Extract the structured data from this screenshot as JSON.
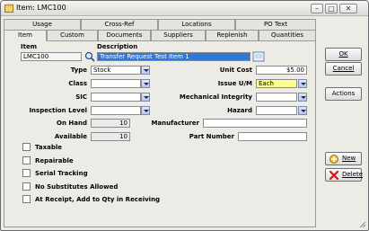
{
  "window": {
    "title": "Item: LMC100"
  },
  "tabs_row1": [
    "Usage",
    "Cross-Ref",
    "Locations",
    "PO Text"
  ],
  "tabs_row2": [
    "Item",
    "Custom",
    "Documents",
    "Suppliers",
    "Replenish",
    "Quantities"
  ],
  "header": {
    "item_label": "Item",
    "item_value": "LMC100",
    "description_label": "Description",
    "description_value": "Transfer Request Test Item 1"
  },
  "fields": {
    "type_label": "Type",
    "type_value": "Stock",
    "class_label": "Class",
    "class_value": "",
    "sic_label": "SIC",
    "sic_value": "",
    "inspection_label": "Inspection Level",
    "inspection_value": "",
    "onhand_label": "On Hand",
    "onhand_value": "10",
    "available_label": "Available",
    "available_value": "10",
    "unitcost_label": "Unit Cost",
    "unitcost_value": "$5.00",
    "issueum_label": "Issue U/M",
    "issueum_value": "Each",
    "mech_label": "Mechanical Integrity",
    "mech_value": "",
    "hazard_label": "Hazard",
    "hazard_value": "",
    "manufacturer_label": "Manufacturer",
    "manufacturer_value": "",
    "partnumber_label": "Part Number",
    "partnumber_value": ""
  },
  "checkboxes": [
    {
      "label": "Taxable",
      "checked": false
    },
    {
      "label": "Repairable",
      "checked": false
    },
    {
      "label": "Serial Tracking",
      "checked": false
    },
    {
      "label": "No Substitutes Allowed",
      "checked": false
    },
    {
      "label": "At Receipt, Add to Qty in Receiving",
      "checked": false
    }
  ],
  "buttons": {
    "ok": "OK",
    "cancel": "Cancel",
    "actions": "Actions",
    "new": "New",
    "delete": "Delete"
  },
  "colors": {
    "required_field": "#ffff8c",
    "selection": "#2f78d6"
  }
}
